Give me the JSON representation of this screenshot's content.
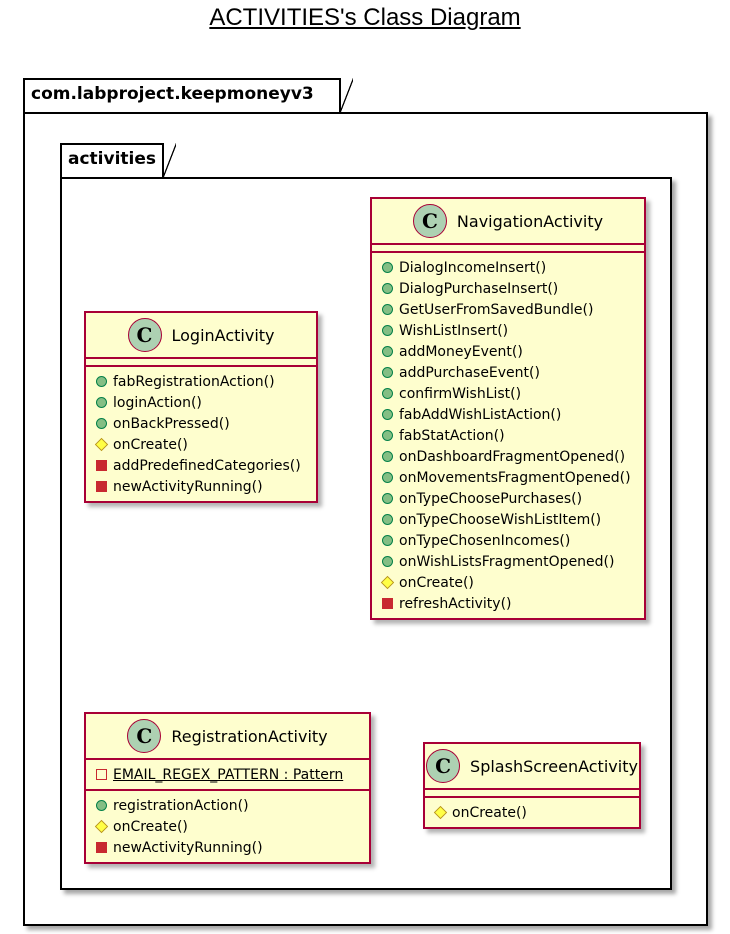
{
  "title": "ACTIVITIES's Class Diagram",
  "outer_package": {
    "name": "com.labproject.keepmoneyv3"
  },
  "inner_package": {
    "name": "activities"
  },
  "classes": {
    "login": {
      "name": "LoginActivity",
      "stereotype_letter": "C",
      "methods": [
        {
          "vis": "public",
          "text": "fabRegistrationAction()"
        },
        {
          "vis": "public",
          "text": "loginAction()"
        },
        {
          "vis": "public",
          "text": "onBackPressed()"
        },
        {
          "vis": "protected",
          "text": "onCreate()"
        },
        {
          "vis": "private",
          "text": "addPredefinedCategories()"
        },
        {
          "vis": "private",
          "text": "newActivityRunning()"
        }
      ]
    },
    "navigation": {
      "name": "NavigationActivity",
      "stereotype_letter": "C",
      "methods": [
        {
          "vis": "public",
          "text": "DialogIncomeInsert()"
        },
        {
          "vis": "public",
          "text": "DialogPurchaseInsert()"
        },
        {
          "vis": "public",
          "text": "GetUserFromSavedBundle()"
        },
        {
          "vis": "public",
          "text": "WishListInsert()"
        },
        {
          "vis": "public",
          "text": "addMoneyEvent()"
        },
        {
          "vis": "public",
          "text": "addPurchaseEvent()"
        },
        {
          "vis": "public",
          "text": "confirmWishList()"
        },
        {
          "vis": "public",
          "text": "fabAddWishListAction()"
        },
        {
          "vis": "public",
          "text": "fabStatAction()"
        },
        {
          "vis": "public",
          "text": "onDashboardFragmentOpened()"
        },
        {
          "vis": "public",
          "text": "onMovementsFragmentOpened()"
        },
        {
          "vis": "public",
          "text": "onTypeChoosePurchases()"
        },
        {
          "vis": "public",
          "text": "onTypeChooseWishListItem()"
        },
        {
          "vis": "public",
          "text": "onTypeChosenIncomes()"
        },
        {
          "vis": "public",
          "text": "onWishListsFragmentOpened()"
        },
        {
          "vis": "protected",
          "text": "onCreate()"
        },
        {
          "vis": "private",
          "text": "refreshActivity()"
        }
      ]
    },
    "registration": {
      "name": "RegistrationActivity",
      "stereotype_letter": "C",
      "attributes": [
        {
          "vis": "private",
          "text": "EMAIL_REGEX_PATTERN : Pattern",
          "static": true
        }
      ],
      "methods": [
        {
          "vis": "public",
          "text": "registrationAction()"
        },
        {
          "vis": "protected",
          "text": "onCreate()"
        },
        {
          "vis": "private",
          "text": "newActivityRunning()"
        }
      ]
    },
    "splash": {
      "name": "SplashScreenActivity",
      "stereotype_letter": "C",
      "methods": [
        {
          "vis": "protected",
          "text": "onCreate()"
        }
      ]
    }
  }
}
